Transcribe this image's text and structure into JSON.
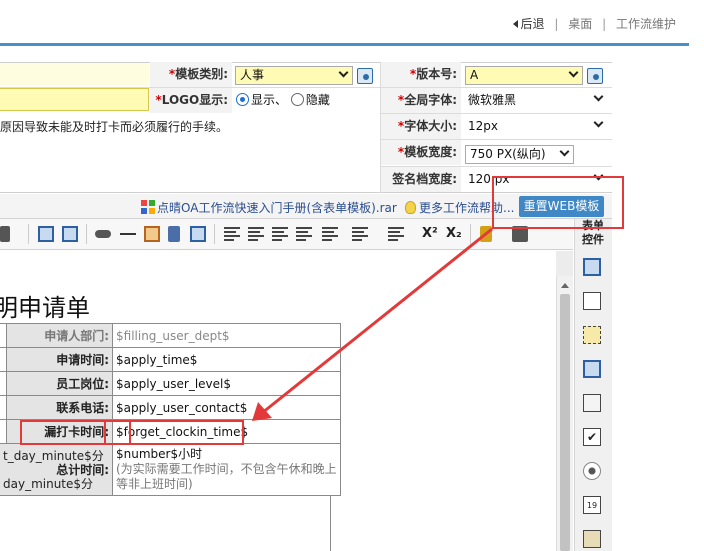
{
  "nav": {
    "back": "后退",
    "desktop": "桌面",
    "workflow": "工作流维护"
  },
  "settings": {
    "template_category_label": "模板类别:",
    "template_category_value": "人事",
    "logo_label": "LOGO显示:",
    "logo_show": "显示、",
    "logo_hide": "隐藏",
    "version_label": "版本号:",
    "version_value": "A",
    "global_font_label": "全局字体:",
    "global_font_value": "微软雅黑",
    "font_size_label": "字体大小:",
    "font_size_value": "12px",
    "template_width_label": "模板宽度:",
    "template_width_value": "750   PX(纵向)",
    "signature_width_label": "签名档宽度:",
    "signature_width_value": "120 px",
    "description": "原因导致未能及时打卡而必须履行的手续。",
    "required_mark": "*"
  },
  "links": {
    "manual": "点晴OA工作流快速入门手册(含表单模板).rar",
    "more_help": "更多工作流帮助...",
    "reset_button": "重置WEB模板"
  },
  "toolbar": {
    "superscript": "X²",
    "subscript": "X₂"
  },
  "sidebar": {
    "title": "表单控件"
  },
  "document": {
    "title": "明申请单",
    "rows": [
      {
        "label": "申请人部门:",
        "value": "$filling_user_dept$",
        "gray": true
      },
      {
        "label": "申请时间:",
        "value": "$apply_time$"
      },
      {
        "label": "员工岗位:",
        "value": "$apply_user_level$"
      },
      {
        "label": "联系电话:",
        "value": "$apply_user_contact$"
      },
      {
        "label": "漏打卡时间:",
        "value": "$forget_clockin_time$"
      }
    ],
    "total_left_top": "t_day_minute$分",
    "total_label": "总计时间:",
    "total_left_bottom": "day_minute$分",
    "total_value": "$number$小时",
    "total_note_1": "(为实际需要工作时间，不包含午休和晚上",
    "total_note_2": "等非上班时间)"
  },
  "colors": {
    "accent": "#4a90c8",
    "highlight": "#e23a3a",
    "button": "#3f88c5"
  }
}
